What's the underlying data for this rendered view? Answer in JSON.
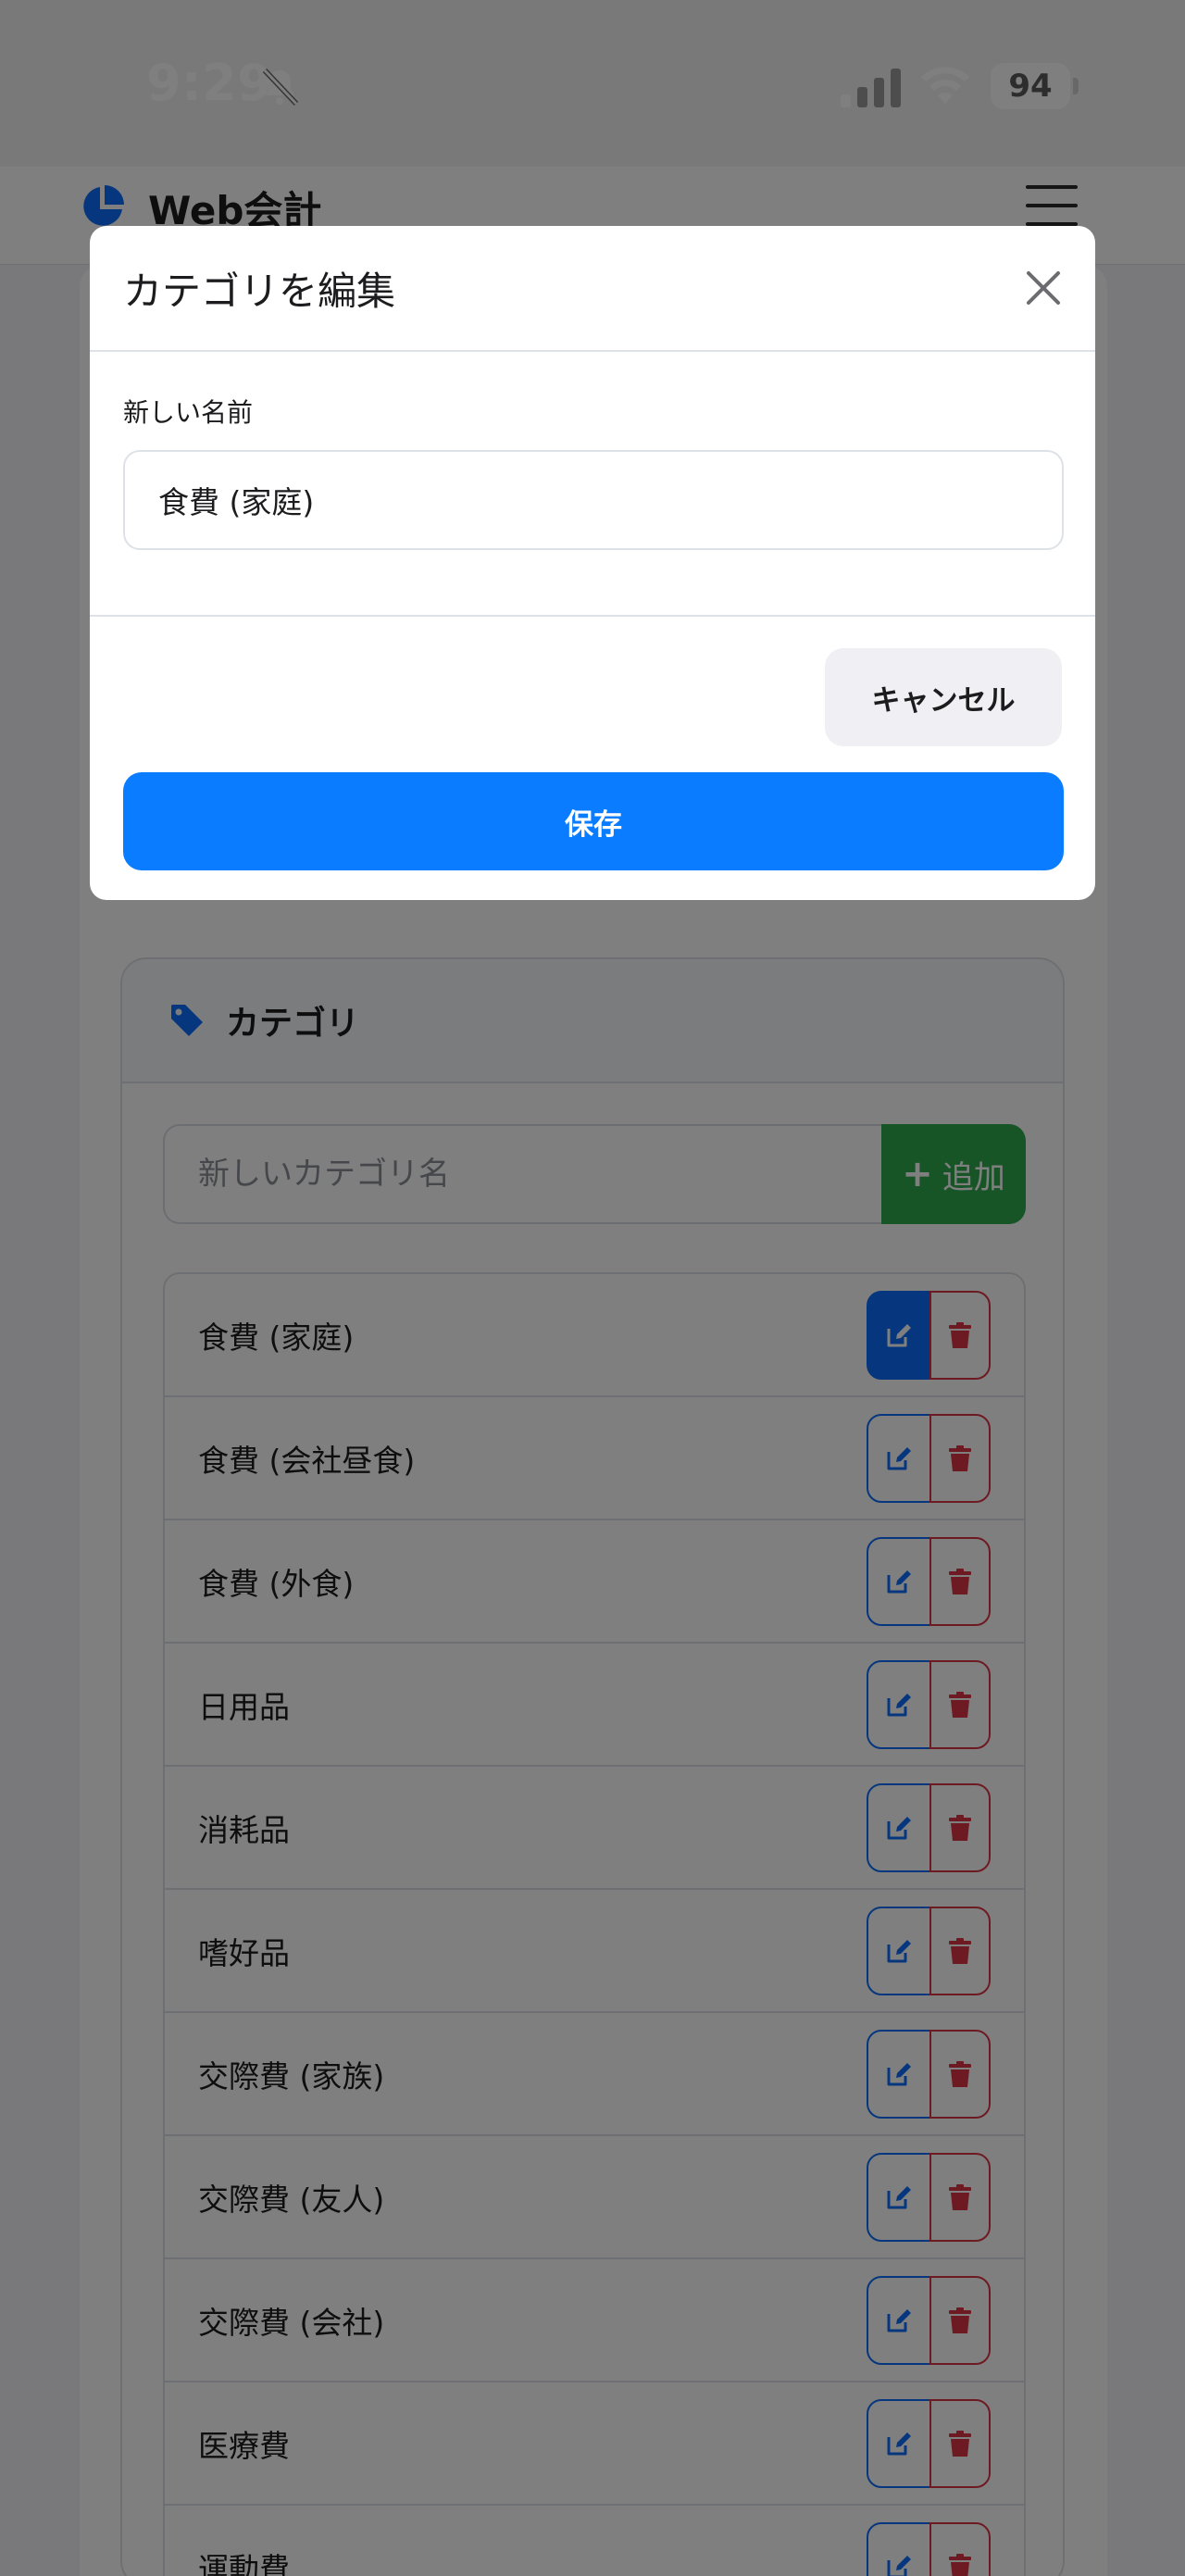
{
  "status_bar": {
    "time": "9:29",
    "battery": "94",
    "icons": [
      "bell-slash-icon",
      "cellular-signal-icon",
      "wifi-icon",
      "battery-icon"
    ]
  },
  "navbar": {
    "brand": "Web会計",
    "brand_icon": "pie-chart-icon",
    "menu_icon": "hamburger-menu-icon"
  },
  "modal": {
    "title": "カテゴリを編集",
    "field_label": "新しい名前",
    "field_value": "食費 (家庭)",
    "cancel_label": "キャンセル",
    "save_label": "保存"
  },
  "category_card": {
    "title": "カテゴリ",
    "icon": "tag-icon",
    "new_placeholder": "新しいカテゴリ名",
    "add_label": "追加",
    "items": [
      {
        "label": "食費 (家庭)",
        "active": true
      },
      {
        "label": "食費 (会社昼食)"
      },
      {
        "label": "食費 (外食)"
      },
      {
        "label": "日用品"
      },
      {
        "label": "消耗品"
      },
      {
        "label": "嗜好品"
      },
      {
        "label": "交際費 (家族)"
      },
      {
        "label": "交際費 (友人)"
      },
      {
        "label": "交際費 (会社)"
      },
      {
        "label": "医療費"
      },
      {
        "label": "運動費"
      }
    ]
  },
  "colors": {
    "primary": "#0a7cff",
    "edit_border": "#0d6efd",
    "delete": "#dc3545",
    "add_green": "#2ea84c"
  }
}
